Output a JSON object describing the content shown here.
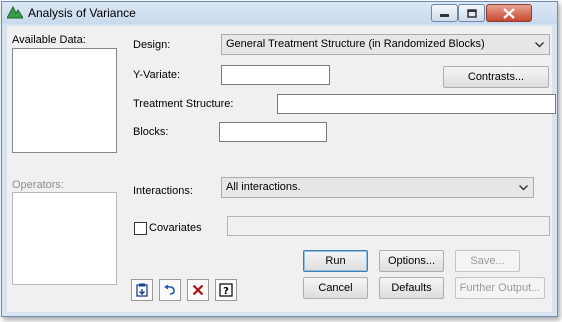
{
  "window": {
    "title": "Analysis of Variance"
  },
  "left_panel": {
    "available_data_label": "Available Data:",
    "operators_label": "Operators:"
  },
  "form": {
    "design_label": "Design:",
    "design_value": "General Treatment Structure (in Randomized Blocks)",
    "y_variate_label": "Y-Variate:",
    "y_variate_value": "",
    "contrasts_label": "Contrasts...",
    "treatment_structure_label": "Treatment Structure:",
    "treatment_structure_value": "",
    "blocks_label": "Blocks:",
    "blocks_value": "",
    "interactions_label": "Interactions:",
    "interactions_value": "All interactions.",
    "covariates_label": "Covariates",
    "covariates_checked": false,
    "covariates_value": ""
  },
  "buttons": {
    "run": "Run",
    "options": "Options...",
    "save": "Save...",
    "cancel": "Cancel",
    "defaults": "Defaults",
    "further_output": "Further Output..."
  },
  "toolbar": {
    "icons": [
      "clipboard-icon",
      "undo-icon",
      "clear-icon",
      "help-icon"
    ]
  },
  "colors": {
    "window_frame": "#d7e4f2",
    "client_bg": "#f0f0f0",
    "close_button": "#c7472f",
    "default_button_border": "#3c7fb1"
  }
}
